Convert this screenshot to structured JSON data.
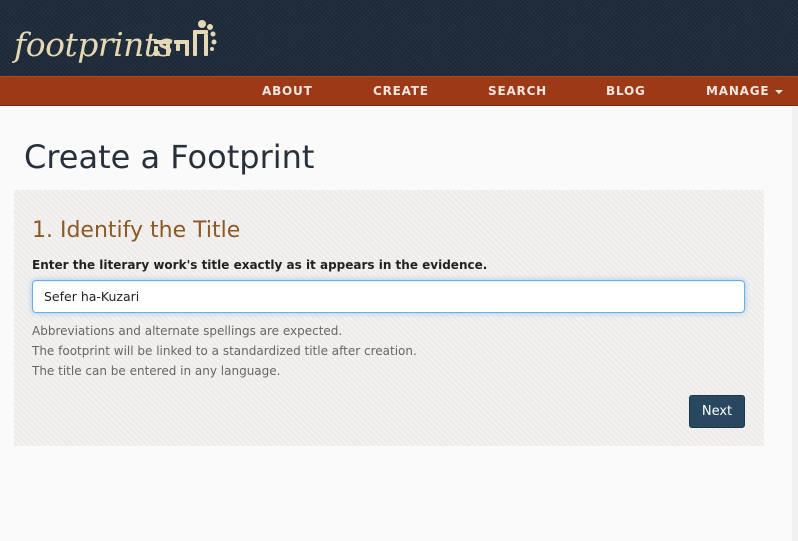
{
  "header": {
    "logo_text": "footprints",
    "logo_hebrew_text": "פתח"
  },
  "nav": {
    "items": [
      {
        "label": "ABOUT"
      },
      {
        "label": "CREATE"
      },
      {
        "label": "SEARCH"
      },
      {
        "label": "BLOG"
      },
      {
        "label": "MANAGE",
        "icon": "caret-down-icon"
      }
    ]
  },
  "main": {
    "title": "Create a Footprint",
    "step": {
      "heading": "1. Identify the Title",
      "field_label": "Enter the literary work's title exactly as it appears in the evidence.",
      "input_value": "Sefer ha-Kuzari",
      "help_lines": [
        "Abbreviations and alternate spellings are expected.",
        "The footprint will be linked to a standardized title after creation.",
        "The title can be entered in any language."
      ],
      "next_label": "Next"
    }
  },
  "colors": {
    "header_bg": "#1f2c3b",
    "nav_bg": "#9c3a17",
    "heading_accent": "#8b5a24",
    "button_bg": "#27485e",
    "input_focus": "#66afe9"
  }
}
